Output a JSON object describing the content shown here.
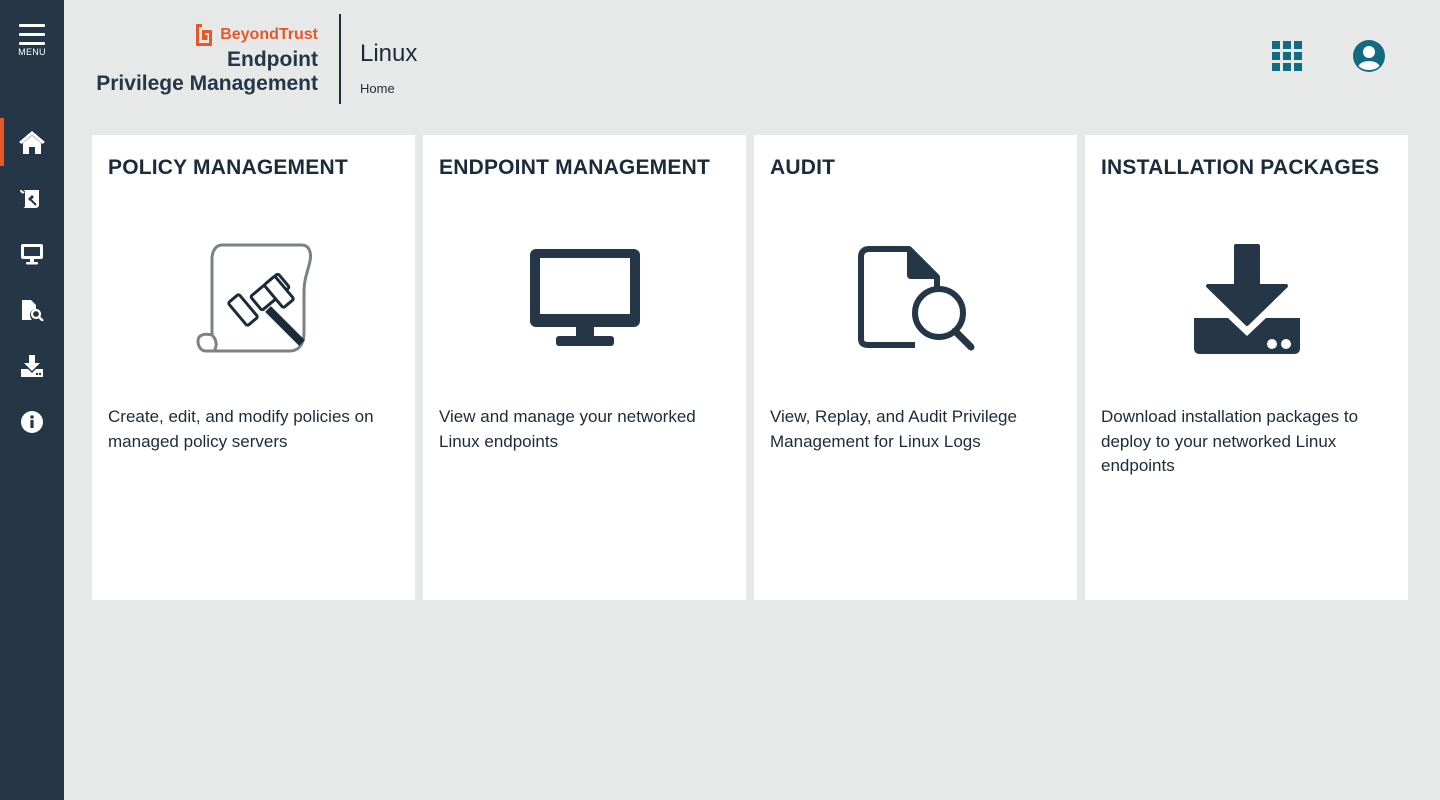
{
  "sidebar": {
    "menu_label": "MENU",
    "items": [
      {
        "name": "home",
        "icon": "home-icon",
        "active": true
      },
      {
        "name": "policies",
        "icon": "policy-icon"
      },
      {
        "name": "endpoints",
        "icon": "monitor-icon"
      },
      {
        "name": "audit",
        "icon": "audit-icon"
      },
      {
        "name": "downloads",
        "icon": "download-icon"
      },
      {
        "name": "info",
        "icon": "info-icon"
      }
    ]
  },
  "header": {
    "brand_logo": "BeyondTrust",
    "brand_line1": "Endpoint",
    "brand_line2": "Privilege Management",
    "title": "Linux",
    "breadcrumb": "Home",
    "apps_icon": "apps-grid-icon",
    "user_icon": "user-avatar-icon"
  },
  "cards": [
    {
      "title": "POLICY MANAGEMENT",
      "icon": "gavel-scroll-icon",
      "description": "Create, edit, and modify policies on managed policy servers"
    },
    {
      "title": "ENDPOINT MANAGEMENT",
      "icon": "monitor-icon",
      "description": "View and manage your networked Linux endpoints"
    },
    {
      "title": "AUDIT",
      "icon": "file-search-icon",
      "description": "View, Replay, and Audit Privilege Management for Linux Logs"
    },
    {
      "title": "INSTALLATION PACKAGES",
      "icon": "download-icon",
      "description": "Download installation packages to deploy to your networked Linux endpoints"
    }
  ],
  "colors": {
    "sidebar_bg": "#253746",
    "accent": "#e8572a",
    "teal": "#126b80",
    "page_bg": "#e7e8e8",
    "card_bg": "#ffffff"
  }
}
